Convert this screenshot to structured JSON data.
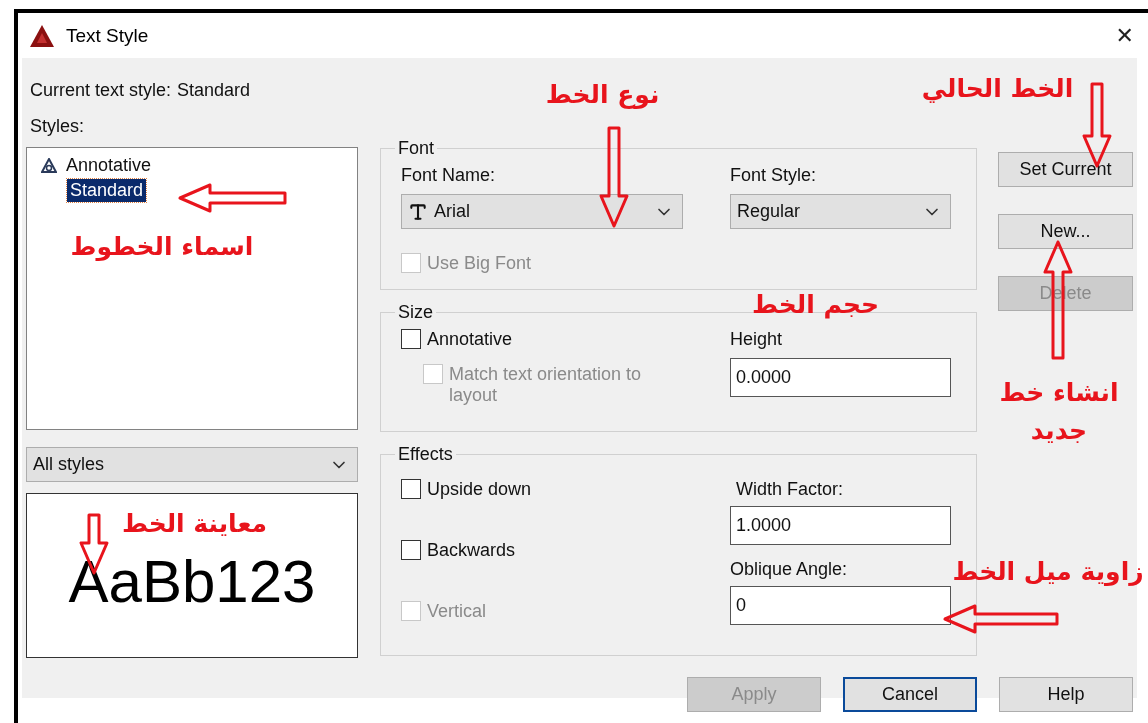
{
  "window": {
    "title": "Text Style",
    "close": "✕"
  },
  "current_style": {
    "label": "Current text style:",
    "value": "Standard"
  },
  "styles": {
    "label": "Styles:",
    "items": [
      {
        "name": "Annotative",
        "annotative": true,
        "selected": false
      },
      {
        "name": "Standard",
        "annotative": false,
        "selected": true
      }
    ],
    "filter": "All styles",
    "preview": "AaBb123"
  },
  "font": {
    "legend": "Font",
    "font_name": {
      "label": "Font Name:",
      "value": "Arial"
    },
    "font_style": {
      "label": "Font Style:",
      "value": "Regular"
    },
    "use_big_font": {
      "label": "Use Big Font",
      "checked": false,
      "disabled": true
    }
  },
  "size": {
    "legend": "Size",
    "annotative": {
      "label": "Annotative",
      "checked": false,
      "disabled": false
    },
    "match_orientation": {
      "label": "Match text orientation to layout",
      "checked": false,
      "disabled": true
    },
    "height": {
      "label": "Height",
      "value": "0.0000"
    }
  },
  "effects": {
    "legend": "Effects",
    "options": [
      {
        "label": "Upside down",
        "checked": false,
        "disabled": false
      },
      {
        "label": "Backwards",
        "checked": false,
        "disabled": false
      },
      {
        "label": "Vertical",
        "checked": false,
        "disabled": true
      }
    ],
    "width_factor": {
      "label": "Width Factor:",
      "value": "1.0000"
    },
    "oblique_angle": {
      "label": "Oblique Angle:",
      "value": "0"
    }
  },
  "side_buttons": [
    {
      "label": "Set Current",
      "disabled": false
    },
    {
      "label": "New...",
      "disabled": false
    },
    {
      "label": "Delete",
      "disabled": true
    }
  ],
  "footer_buttons": [
    {
      "label": "Apply",
      "disabled": true,
      "default": false
    },
    {
      "label": "Cancel",
      "disabled": false,
      "default": true
    },
    {
      "label": "Help",
      "disabled": false,
      "default": false
    }
  ],
  "annotations": [
    {
      "text": "اسماء الخطوط"
    },
    {
      "text": "نوع الخط"
    },
    {
      "text": "الخط الحالي"
    },
    {
      "text": "حجم الخط"
    },
    {
      "text": "انشاء خط جديد"
    },
    {
      "text": "معاينة الخط"
    },
    {
      "text": "زاوية ميل الخط"
    }
  ]
}
